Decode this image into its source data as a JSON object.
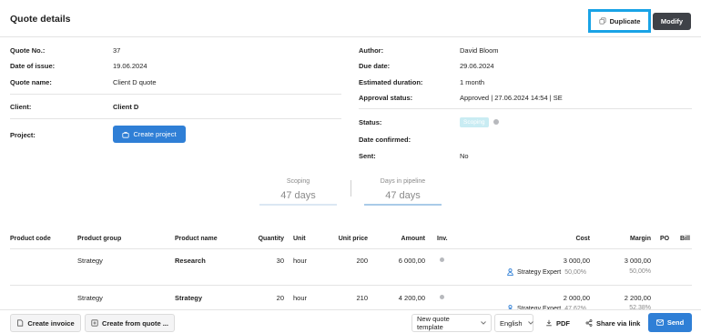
{
  "header": {
    "title": "Quote details",
    "duplicate_label": "Duplicate",
    "modify_label": "Modify"
  },
  "left_fields": {
    "quote_no": {
      "label": "Quote No.:",
      "value": "37"
    },
    "date_of_issue": {
      "label": "Date of issue:",
      "value": "19.06.2024"
    },
    "quote_name": {
      "label": "Quote name:",
      "value": "Client D quote"
    },
    "client": {
      "label": "Client:",
      "value": "Client D"
    },
    "project": {
      "label": "Project:",
      "button": "Create project"
    }
  },
  "right_fields": {
    "author": {
      "label": "Author:",
      "value": "David Bloom"
    },
    "due_date": {
      "label": "Due date:",
      "value": "29.06.2024"
    },
    "estimated_duration": {
      "label": "Estimated duration:",
      "value": "1 month"
    },
    "approval_status": {
      "label": "Approval status:",
      "value": "Approved | 27.06.2024 14:54 | SE"
    },
    "status": {
      "label": "Status:",
      "badge": "Scoping"
    },
    "date_confirmed": {
      "label": "Date confirmed:",
      "value": ""
    },
    "sent": {
      "label": "Sent:",
      "value": "No"
    }
  },
  "pipeline": {
    "stage": {
      "title": "Scoping",
      "value": "47 days"
    },
    "days_in_pipeline": {
      "title": "Days in pipeline",
      "value": "47 days"
    }
  },
  "table": {
    "headers": [
      "Product code",
      "Product group",
      "Product name",
      "Quantity",
      "Unit",
      "Unit price",
      "Amount",
      "Inv.",
      "Cost",
      "Margin",
      "PO",
      "Bill"
    ],
    "rows": [
      {
        "product_code": "",
        "product_group": "Strategy",
        "product_name": "Research",
        "quantity": "30",
        "unit": "hour",
        "unit_price": "200",
        "amount": "6 000,00",
        "cost": "3 000,00",
        "margin": "3 000,00",
        "resource": "Strategy Expert",
        "resource_pct": "50,00%",
        "margin_pct": "50,00%"
      },
      {
        "product_code": "",
        "product_group": "Strategy",
        "product_name": "Strategy",
        "quantity": "20",
        "unit": "hour",
        "unit_price": "210",
        "amount": "4 200,00",
        "cost": "2 000,00",
        "margin": "2 200,00",
        "resource": "Strategy Expert",
        "resource_pct": "47,62%",
        "margin_pct": "52,38%"
      }
    ]
  },
  "footer": {
    "create_invoice": "Create invoice",
    "create_from_quote": "Create from quote ...",
    "template": "New quote template",
    "language": "English",
    "pdf": "PDF",
    "share": "Share via link",
    "send": "Send"
  },
  "colors": {
    "primary": "#2f7fd6",
    "highlight": "#19a3e6",
    "badge": "#c9ecf3",
    "dark_button": "#3f4248",
    "stage_line": "#a9cbe8"
  },
  "icons": [
    "copy-icon",
    "briefcase-icon",
    "invoice-icon",
    "plus-box-icon",
    "chevron-down-icon",
    "pdf-icon",
    "share-icon",
    "send-icon",
    "person-icon"
  ]
}
